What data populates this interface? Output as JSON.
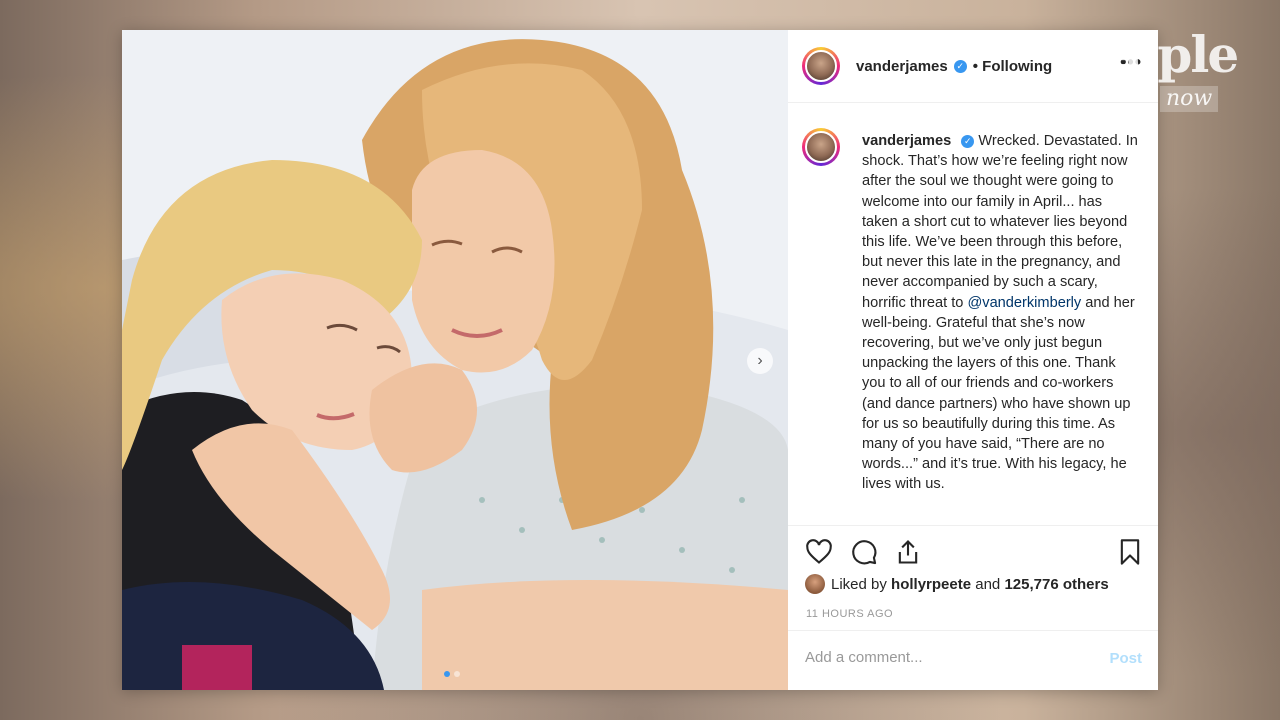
{
  "post": {
    "username": "vanderjames",
    "following_label": "Following",
    "verified_glyph": "✓",
    "more_glyph": "•••",
    "caption_username": "vanderjames",
    "caption_part1": "Wrecked. Devastated. In shock. That’s how we’re feeling right now after the soul we thought were going to welcome into our family in April... has taken a short cut to whatever lies beyond this life. We’ve been through this before, but never this late in the pregnancy, and never accompanied by such a scary, horrific threat to",
    "mention": "@vanderkimberly",
    "caption_part2": "and her well-being. Grateful that she’s now recovering, but we’ve only just begun unpacking the layers of this one. Thank you to all of our friends and co-workers (and dance partners) who have shown up for us so beautifully during this time. As many of you have said, “There are no words...” and it’s true. With his legacy, he lives with us.",
    "liked_by_prefix": "Liked by",
    "liked_by_user": "hollyrpeete",
    "liked_by_and": "and",
    "likes_count": "125,776 others",
    "timestamp": "11 HOURS AGO",
    "comment_placeholder": "Add a comment...",
    "post_button": "Post",
    "next_glyph": "›"
  },
  "carousel": {
    "total": 2,
    "current": 1
  },
  "watermark": {
    "brand": "People",
    "sub": "now"
  },
  "colors": {
    "accent": "#3897f0",
    "mention": "#003569",
    "post_disabled": "#b2dffc"
  },
  "icons": [
    "heart-icon",
    "comment-icon",
    "share-icon",
    "bookmark-icon",
    "verified-icon",
    "more-icon",
    "chevron-right-icon"
  ]
}
